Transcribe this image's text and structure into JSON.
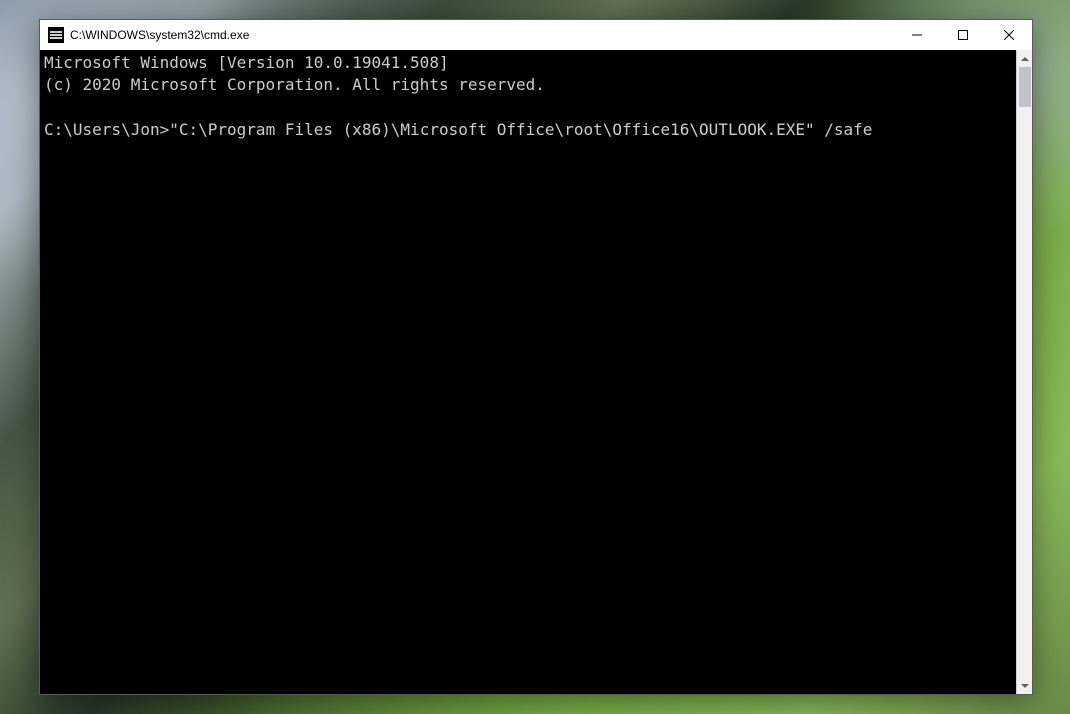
{
  "window": {
    "title": "C:\\WINDOWS\\system32\\cmd.exe"
  },
  "console": {
    "line1": "Microsoft Windows [Version 10.0.19041.508]",
    "line2": "(c) 2020 Microsoft Corporation. All rights reserved.",
    "blank": "",
    "prompt": "C:\\Users\\Jon>",
    "command": "\"C:\\Program Files (x86)\\Microsoft Office\\root\\Office16\\OUTLOOK.EXE\" /safe"
  }
}
